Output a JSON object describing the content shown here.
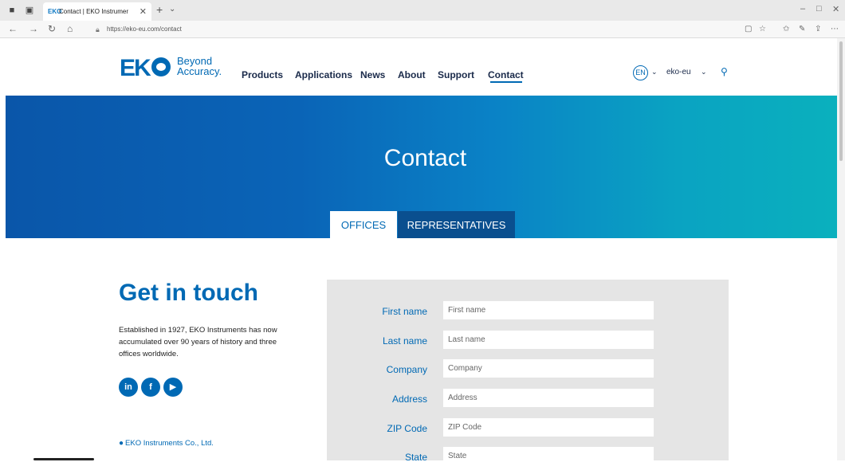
{
  "browser": {
    "tab_title": "Contact | EKO Instrumer",
    "tab_favicon": "EKO",
    "url": "https://eko-eu.com/contact",
    "icons": {
      "close_tab": "close-icon",
      "new_tab": "plus-icon",
      "back": "arrow-left-icon",
      "forward": "arrow-right-icon",
      "refresh": "refresh-icon",
      "home": "home-icon",
      "lock": "lock-icon"
    }
  },
  "header": {
    "logo_text": "EK",
    "tagline_line1": "Beyond",
    "tagline_line2": "Accuracy.",
    "nav": [
      "Products",
      "Applications",
      "News",
      "About",
      "Support",
      "Contact"
    ],
    "active_nav": "Contact",
    "language": "EN",
    "region": "eko-eu"
  },
  "hero": {
    "title": "Contact",
    "tabs": [
      "OFFICES",
      "REPRESENTATIVES"
    ],
    "active_tab": "OFFICES"
  },
  "intro": {
    "heading": "Get in touch",
    "body": "Established in 1927, EKO Instruments has now accumulated over 90 years of history and three offices worldwide.",
    "social": [
      {
        "name": "linkedin",
        "glyph": "in"
      },
      {
        "name": "facebook",
        "glyph": "f"
      },
      {
        "name": "youtube",
        "glyph": "▶"
      }
    ],
    "office_name": "EKO Instruments Co., Ltd."
  },
  "form": {
    "fields": [
      {
        "label": "First name",
        "placeholder": "First name"
      },
      {
        "label": "Last name",
        "placeholder": "Last name"
      },
      {
        "label": "Company",
        "placeholder": "Company"
      },
      {
        "label": "Address",
        "placeholder": "Address"
      },
      {
        "label": "ZIP Code",
        "placeholder": "ZIP Code"
      },
      {
        "label": "State",
        "placeholder": "State"
      }
    ]
  },
  "colors": {
    "brand_blue": "#0069b4",
    "tab_dark": "#0a4f8f",
    "form_bg": "#e5e5e5"
  }
}
